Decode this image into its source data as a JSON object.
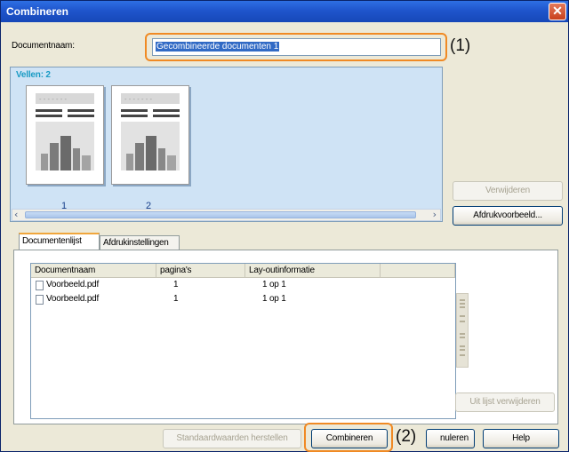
{
  "window": {
    "title": "Combineren",
    "close_glyph": "✕"
  },
  "document_name": {
    "label": "Documentnaam:",
    "value": "Gecombineerde documenten 1"
  },
  "callouts": {
    "first": "(1)",
    "second": "(2)"
  },
  "preview": {
    "sheets_label": "Vellen: 2",
    "pages": [
      {
        "number": "1"
      },
      {
        "number": "2"
      }
    ],
    "scroll_left": "‹",
    "scroll_right": "›"
  },
  "side_buttons": {
    "remove": "Verwijderen",
    "print_preview": "Afdrukvoorbeeld..."
  },
  "tabs": [
    {
      "label": "Documentenlijst"
    },
    {
      "label": "Afdrukinstellingen"
    }
  ],
  "doc_list": {
    "columns": [
      "Documentnaam",
      "pagina's",
      "Lay-outinformatie"
    ],
    "rows": [
      {
        "name": "Voorbeeld.pdf",
        "pages": "1",
        "layout": "1 op 1"
      },
      {
        "name": "Voorbeeld.pdf",
        "pages": "1",
        "layout": "1 op 1"
      }
    ]
  },
  "list_buttons": {
    "remove_from_list": "Uit lijst verwijderen"
  },
  "footer": {
    "restore_defaults": "Standaardwaarden herstellen",
    "combine": "Combineren",
    "cancel": "nuleren",
    "help": "Help"
  },
  "colors": {
    "accent_orange": "#f08a24",
    "titlebar_blue": "#1f55cc",
    "selection_blue": "#316ac5",
    "preview_bg": "#cfe3f5"
  }
}
